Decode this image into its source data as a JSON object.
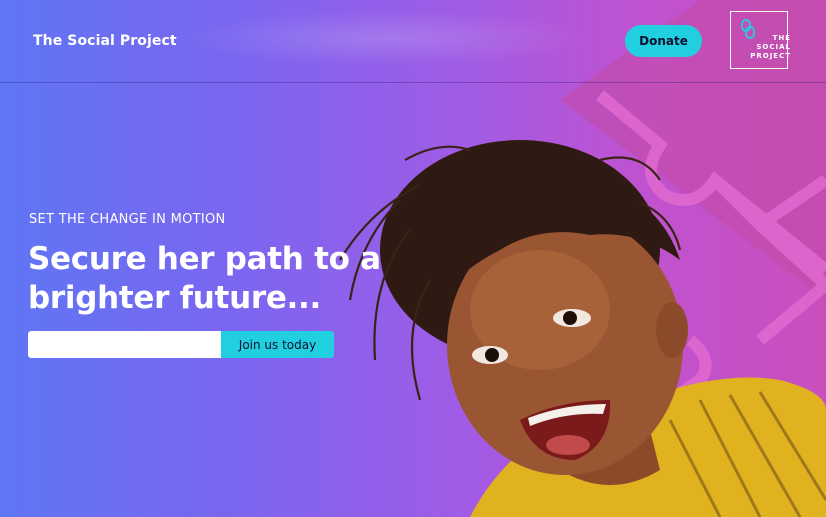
{
  "header": {
    "brand_name": "The Social Project",
    "donate_label": "Donate",
    "logo": {
      "line1": "THE",
      "line2": "SOCIAL",
      "line3": "PROJECT"
    }
  },
  "hero": {
    "eyebrow": "SET THE CHANGE IN MOTION",
    "headline": "Secure her path to a brighter future...",
    "email_value": "",
    "email_placeholder": "",
    "join_label": "Join us today",
    "photo_icon": "smiling-child-photo"
  },
  "colors": {
    "accent": "#21cfe0",
    "gradient_start": "#5f76f4",
    "gradient_end": "#c84fbd",
    "puzzle": "#e06ad0"
  }
}
